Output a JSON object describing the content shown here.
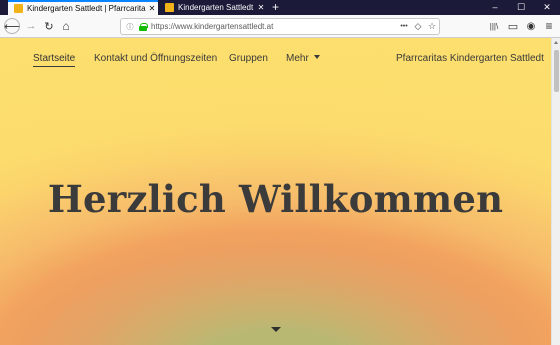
{
  "browser": {
    "tabs": [
      {
        "title": "Kindergarten Sattledt | Pfarrcaritas K",
        "active": true,
        "favicon_color": "#f2b319"
      },
      {
        "title": "Kindergarten Sattledt",
        "active": false,
        "favicon_color": "#f2b319"
      }
    ],
    "close_glyph": "✕",
    "new_tab_glyph": "+",
    "window_controls": {
      "minimize": "–",
      "maximize": "☐",
      "close": "✕"
    },
    "toolbar": {
      "back_icon": "⟵",
      "forward_icon": "→",
      "reload_icon": "↻",
      "home_icon": "⌂",
      "info_icon": "ⓘ",
      "url": "https://www.kindergartensattledt.at",
      "page_actions_icon": "•••",
      "pocket_icon": "◇",
      "bookmark_icon": "☆",
      "library_icon": "|||\\",
      "sidebar_icon": "▭",
      "account_icon": "◉",
      "menu_icon": "≡",
      "lock_color": "#12bc00"
    }
  },
  "site": {
    "nav": {
      "items": [
        {
          "label": "Startseite",
          "active": true
        },
        {
          "label": "Kontakt und Öffnungszeiten"
        },
        {
          "label": "Gruppen"
        },
        {
          "label": "Mehr",
          "has_dropdown": true
        }
      ],
      "brand": "Pfarrcaritas Kindergarten Sattledt"
    },
    "hero": {
      "title": "Herzlich Willkommen"
    },
    "colors": {
      "background": "#fde06e",
      "text": "#3b3b3b"
    }
  }
}
